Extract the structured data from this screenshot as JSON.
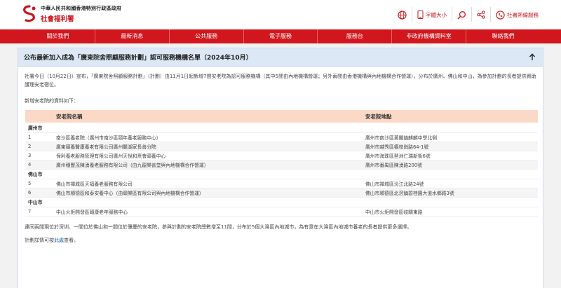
{
  "header": {
    "org_line1": "中華人民共和國香港特別行政區政府",
    "org_line2": "社會福利署",
    "tools": [
      {
        "icon": "globe-icon",
        "label": ""
      },
      {
        "icon": "font-size-icon",
        "label": "字體大小"
      },
      {
        "icon": "search-icon",
        "label": ""
      },
      {
        "icon": "share-icon",
        "label": ""
      },
      {
        "icon": "hotline-icon",
        "label": "社署熱線服務"
      }
    ]
  },
  "nav": {
    "items": [
      "關於我們",
      "最新消息",
      "公共服務",
      "電子服務",
      "服務台",
      "非政府機構資料室",
      "聯絡我們"
    ]
  },
  "panel": {
    "title": "公布最新加入成為「廣東院舍照顧服務計劃」認可服務機構名單（2024年10月）",
    "para1": "社署今日（10月22日）宣布，「廣東院舍照顧服務計劃」（計劃）由11月1日起新增7間安老院為認可服務機構（其中5間由內地機構營運；另外兩間由香港機構與內地機構合作營運），分布於廣州、佛山和中山，為參加計劃的長者提供資助護理安老宿位。",
    "para2": "新增安老院的資料如下：",
    "table": {
      "headers": [
        "",
        "安老院名稱",
        "安老院地點"
      ],
      "groups": [
        {
          "city": "廣州市",
          "rows": [
            {
              "no": "1",
              "name": "南沙區養老院（廣州市南沙區頤年養老服務中心）",
              "address": "廣州市南沙區黃閣鎮麒麟中學北側"
            },
            {
              "no": "2",
              "name": "廣東頤養醫康養老有限公司廣州麓湖家長善分院",
              "address": "廣州市越秀區橫枝崗路64-1號"
            },
            {
              "no": "3",
              "name": "保利養老服務管理有限公司廣州天悅和熹會頤養中心",
              "address": "廣州市海珠區琶洲仁瑞新街6號"
            },
            {
              "no": "4",
              "name": "廣州穗豐茂陳湧養老服務有限公司（由九龍樂善堂與內地機構合作營運）",
              "address": "廣州市番禺區陳湧路200號"
            }
          ]
        },
        {
          "city": "佛山市",
          "rows": [
            {
              "no": "5",
              "name": "佛山市禪城區天福養老服務有限公司",
              "address": "佛山市禪城區汾江北路24號"
            },
            {
              "no": "6",
              "name": "佛山市順德區和泰安養中心（由頤樂區有限公司與內地機構合作營運）",
              "address": "佛山市順德區北滘鎮碧桂園大道水鄉路3號"
            }
          ]
        },
        {
          "city": "中山市",
          "rows": [
            {
              "no": "7",
              "name": "中山火炬開發區頤康老年服務中心",
              "address": "中山市火炬開發區岐關東路"
            }
          ]
        }
      ]
    },
    "para3": "連同兩間現位於深圳、一間位於佛山和一間位於肇慶的安老院，參與計劃的安老院總數增至11間，分布於5個大灣區內地城市，為有意在大灣區內地城市養老的長者提供更多選擇。",
    "para4_prefix": "計劃詳情可按",
    "para4_link": "此處",
    "para4_suffix": "查看。"
  },
  "colors": {
    "brand_red": "#d1161d",
    "panel_header": "#dce8f5",
    "table_header": "#fbd9c6",
    "link": "#1a5fb4"
  }
}
